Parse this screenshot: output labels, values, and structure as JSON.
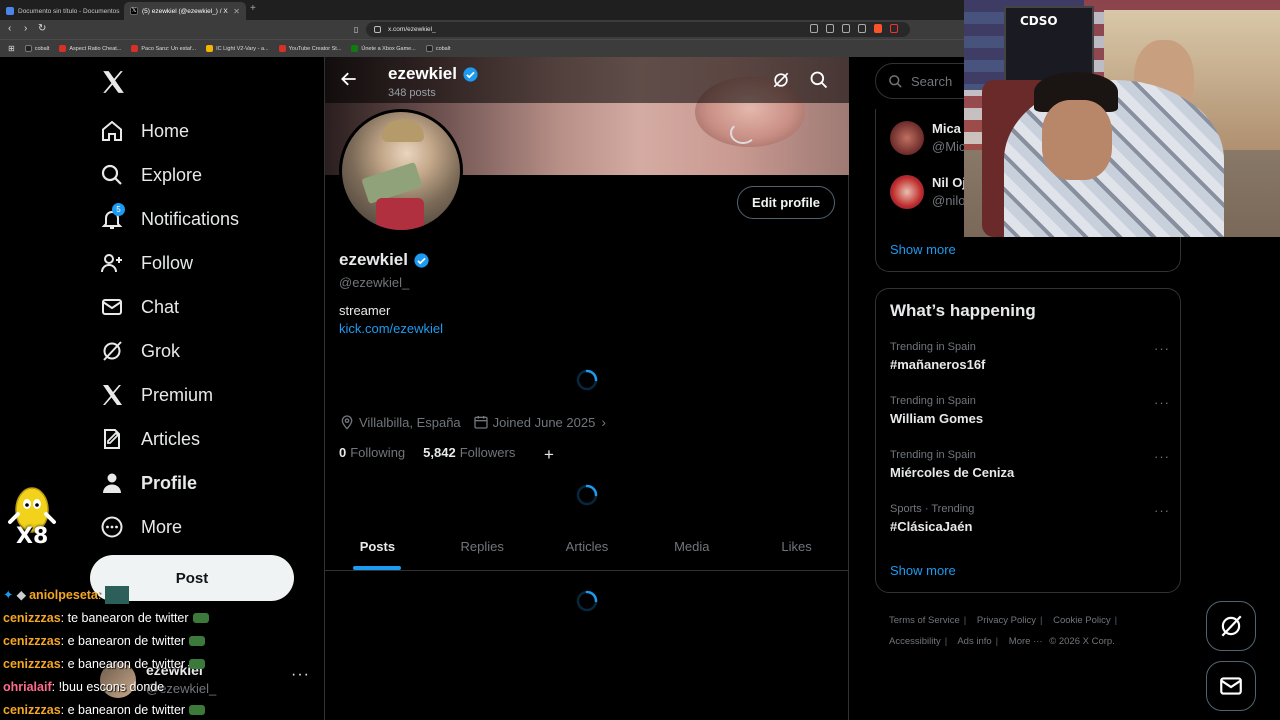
{
  "browser": {
    "tabs": [
      {
        "label": "Documento sin título - Documentos"
      },
      {
        "label": "(5) ezewkiel (@ezewkiel_) / X"
      }
    ],
    "url": "x.com/ezewkiel_",
    "bookmarks": [
      {
        "label": "cobalt",
        "color": "#222222"
      },
      {
        "label": "Aspect Ratio Cheat...",
        "color": "#d93025"
      },
      {
        "label": "Paco Sanz: Un estaf...",
        "color": "#d93025"
      },
      {
        "label": "IC Light V2-Vary - a...",
        "color": "#f4b400"
      },
      {
        "label": "YouTube Creator St...",
        "color": "#d93025"
      },
      {
        "label": "Únete a Xbox Game...",
        "color": "#107c10"
      },
      {
        "label": "cobalt",
        "color": "#222222"
      }
    ]
  },
  "nav": {
    "items": [
      {
        "label": "Home",
        "icon": "home-icon"
      },
      {
        "label": "Explore",
        "icon": "search-icon"
      },
      {
        "label": "Notifications",
        "icon": "bell-icon"
      },
      {
        "label": "Follow",
        "icon": "follow-icon"
      },
      {
        "label": "Chat",
        "icon": "mail-icon"
      },
      {
        "label": "Grok",
        "icon": "grok-icon"
      },
      {
        "label": "Premium",
        "icon": "x-icon"
      },
      {
        "label": "Articles",
        "icon": "article-icon"
      },
      {
        "label": "Profile",
        "icon": "person-icon"
      },
      {
        "label": "More",
        "icon": "more-icon"
      }
    ],
    "notification_count": "5",
    "post_label": "Post",
    "account": {
      "name": "ezewkiel",
      "handle": "@ezewkiel_"
    }
  },
  "profile": {
    "top_name": "ezewkiel",
    "post_count": "348 posts",
    "name": "ezewkiel",
    "handle": "@ezewkiel_",
    "bio": "streamer",
    "link": "kick.com/ezewkiel",
    "location": "Villalbilla, España",
    "joined": "Joined June 2025",
    "following_count": "0",
    "following_label": "Following",
    "followers_count": "5,842",
    "followers_label": "Followers",
    "edit_label": "Edit profile",
    "tabs": [
      "Posts",
      "Replies",
      "Articles",
      "Media",
      "Likes"
    ]
  },
  "sidebar": {
    "search_placeholder": "Search",
    "who_to_follow": [
      {
        "name": "Mica",
        "handle": "@Mic"
      },
      {
        "name": "Nil Oj",
        "handle": "@nilo"
      }
    ],
    "who_show_more": "Show more",
    "trending_title": "What’s happening",
    "trends": [
      {
        "context": "Trending in Spain",
        "name": "#mañaneros16f"
      },
      {
        "context": "Trending in Spain",
        "name": "William Gomes"
      },
      {
        "context": "Trending in Spain",
        "name": "Miércoles de Ceniza"
      },
      {
        "context": "Sports · Trending",
        "name": "#ClásicaJaén"
      }
    ],
    "trend_show_more": "Show more",
    "footer": {
      "terms": "Terms of Service",
      "privacy": "Privacy Policy",
      "cookie": "Cookie Policy",
      "accessibility": "Accessibility",
      "ads": "Ads info",
      "more": "More ···",
      "copyright": "© 2026 X Corp."
    }
  },
  "stream": {
    "emote_label": "X8",
    "webcam_poster": "CDSO",
    "chat": [
      {
        "user": "aniolpeseta",
        "message": "",
        "color": "#f5a623",
        "badges": true
      },
      {
        "user": "cenizzzas",
        "message": "te banearon de twitter",
        "color": "#f5a623"
      },
      {
        "user": "cenizzzas",
        "message": "e banearon de twitter",
        "color": "#f5a623"
      },
      {
        "user": "cenizzzas",
        "message": "e banearon de twitter",
        "color": "#f5a623"
      },
      {
        "user": "ohrialaif",
        "message": "!buu escons donde",
        "color": "#ff6b8a"
      },
      {
        "user": "cenizzzas",
        "message": "e banearon de twitter",
        "color": "#f5a623"
      }
    ]
  },
  "colors": {
    "accent": "#1d9bf0",
    "background": "#000000",
    "border": "#2f3336"
  }
}
